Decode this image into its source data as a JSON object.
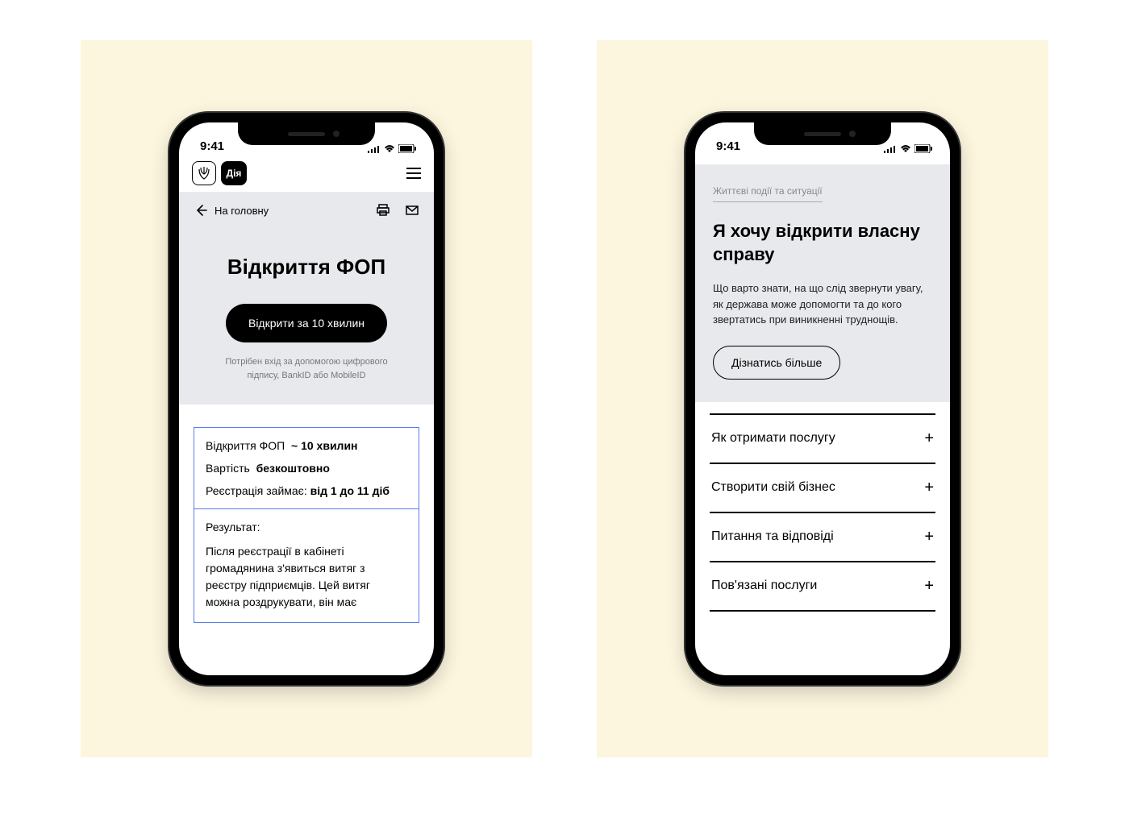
{
  "statusbar": {
    "time": "9:41"
  },
  "phone1": {
    "brand_logo": "Дія",
    "back_label": "На головну",
    "title": "Відкриття ФОП",
    "cta": "Відкрити за 10 хвилин",
    "subnote": "Потрібен вхід за допомогою цифрового підпису, BankID або MobileID",
    "info": {
      "line1_label": "Відкриття ФОП",
      "line1_value": "~ 10 хвилин",
      "line2_label": "Вартість",
      "line2_value": "безкоштовно",
      "line3_label": "Реєстрація займає:",
      "line3_value": "від 1 до 11 діб",
      "result_label": "Результат:",
      "result_text": "Після реєстрації в кабінеті громадянина з'явиться витяг з реєстру підприємців. Цей витяг можна роздрукувати, він має"
    }
  },
  "phone2": {
    "breadcrumb": "Життєві події та ситуації",
    "heading": "Я хочу відкрити власну справу",
    "paragraph": "Що варто знати, на що слід звернути увагу, як держава може допомогти та до кого звертатись при виникненні труднощів.",
    "more_btn": "Дізнатись більше",
    "accordion": [
      "Як отримати послугу",
      "Створити свій бізнес",
      "Питання та відповіді",
      "Пов'язані послуги"
    ]
  }
}
